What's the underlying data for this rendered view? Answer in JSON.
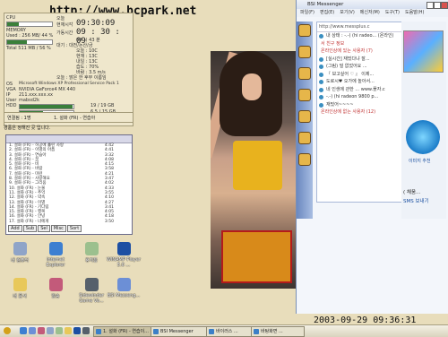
{
  "watermark": "http://www.bcpark.net",
  "sysinfo": {
    "cpu_label": "CPU",
    "cpu_usage": 0.25,
    "memory_label": "MEMORY",
    "memory_text": "Used : 256 MB/ 44 %",
    "memory_usage": 0.44,
    "total_text": "Total 511 MB / 56 %",
    "today_label": "오늘",
    "clock_label": "현재시각",
    "clock": "09:30:09",
    "uptime_label": "가동시간",
    "uptime": "09 : 30 : 09",
    "uptime_sub": "00 시 43 분",
    "weather_label": "대기 : 대전/논산/금",
    "temp": "오늘 : 10C",
    "temp2": "현재 : 13C",
    "temp3": "내일 : 13C",
    "temp4": "습도 : 70%",
    "temp5": "바람 : 3.5 m/s",
    "weather_note": "오늘 : 맑은 한 후부 이름임",
    "os_label": "OS",
    "os": "Microsoft Windows XP Professional Service Pack 1",
    "vga_label": "VGA",
    "vga": "NVIDIA GeForce4 MX 440",
    "ip_label": "IP",
    "ip": "211.xxx.xxx.xx",
    "user_label": "User",
    "user": "mabsd2k",
    "hdd_label": "HDD",
    "hdd_c": "19 / 19 GB",
    "hdd_d": "6.5 / 15 GB",
    "hdd_c_usage": 0.99,
    "hdd_d_usage": 0.43
  },
  "status_strip": {
    "connect": "연결됨 : 1명",
    "track": "1. 설화 (FR) - 연습아"
  },
  "notice": "경품은 정해진 곳 입니다.",
  "media_window": {
    "rows": [
      {
        "title": "1. 설화 (FR) - 허공에 흘린 사랑",
        "dur": "4:42"
      },
      {
        "title": "2. 설화 (FR) - 이별의 아픔",
        "dur": "4:41"
      },
      {
        "title": "3. 설화 (FR) - 연습아",
        "dur": "3:32"
      },
      {
        "title": "4. 설화 (FR) - 꿈",
        "dur": "4:08"
      },
      {
        "title": "5. 설화 (FR) - 비",
        "dur": "4:15"
      },
      {
        "title": "6. 설화 (FR) - 바람",
        "dur": "3:58"
      },
      {
        "title": "7. 설화 (FR) - 미련",
        "dur": "4:21"
      },
      {
        "title": "8. 설화 (FR) - 사랑해요",
        "dur": "3:47"
      },
      {
        "title": "9. 설화 (FR) - 그리움",
        "dur": "4:02"
      },
      {
        "title": "10. 설화 (FR) - 눈물",
        "dur": "4:33"
      },
      {
        "title": "11. 설화 (FR) - 추억",
        "dur": "3:55"
      },
      {
        "title": "12. 설화 (FR) - 약속",
        "dur": "4:10"
      },
      {
        "title": "13. 설화 (FR) - 이별",
        "dur": "4:27"
      },
      {
        "title": "14. 설화 (FR) - 기다림",
        "dur": "3:41"
      },
      {
        "title": "15. 설화 (FR) - 행복",
        "dur": "4:05"
      },
      {
        "title": "16. 설화 (FR) - 안녕",
        "dur": "4:18"
      },
      {
        "title": "17. 설화 (FR) - 너에게",
        "dur": "3:50"
      }
    ],
    "buttons": [
      "Add",
      "Sub",
      "Sel",
      "Misc",
      "Sort"
    ]
  },
  "desktop_icons": [
    {
      "label": "내 컴퓨터",
      "color": "#8fa4c8"
    },
    {
      "label": "Internet Explorer",
      "color": "#3d7fd1"
    },
    {
      "label": "휴지통",
      "color": "#9cc08e"
    },
    {
      "label": "WINAMP Player 5.0 ...",
      "color": "#1d4fa3"
    },
    {
      "label": "내 문서",
      "color": "#e8c85a"
    },
    {
      "label": "알송",
      "color": "#c35a7a"
    },
    {
      "label": "Sidewinder Game Vo...",
      "color": "#56606b"
    },
    {
      "label": "BSI Messeng...",
      "color": "#6c8fd6"
    }
  ],
  "messenger": {
    "title": "BSI Messenger",
    "menu": [
      "파일(F)",
      "편집(E)",
      "보기(V)",
      "메신저(M)",
      "도구(T)",
      "도움말(H)"
    ],
    "url": "http://www.messplus.c",
    "contacts": [
      {
        "text": "내 상태 : -.-) (hi radeo... (온라인)",
        "group": false
      },
      {
        "text": "서 친구 정보",
        "group": true
      },
      {
        "text": "온라인상에 있는 사용자 (7)",
        "group": true
      },
      {
        "text": "[실시간] 재밌다냐 잘...",
        "group": false
      },
      {
        "text": "(그림) 덜 없었어요 ...",
        "group": false
      },
      {
        "text": "『 보고싶어 ♡ 』 이제...",
        "group": false
      },
      {
        "text": "도로시♥ 오가에 놀아서...",
        "group": false
      },
      {
        "text": "네 인생에 관한 ... www.플자.c",
        "group": false
      },
      {
        "text": "-.-) (hi radeon 9800 p...",
        "group": false
      },
      {
        "text": "재밌어~~~~",
        "group": false
      },
      {
        "text": "온라인상에 없는 사용자 (12)",
        "group": true
      }
    ],
    "promo_label": "이미지 추천",
    "right_text": "( 채움...",
    "sms_label": "SMS 보내기"
  },
  "datetime": "2003-09-29 09:36:31",
  "taskbar": {
    "buttons": [
      {
        "label": "1. 설화 (FR) - 연습이...",
        "active": true
      },
      {
        "label": "BSI Messenger",
        "active": false
      },
      {
        "label": "바이러스 ...",
        "active": false
      },
      {
        "label": "바탕화면 ...",
        "active": false
      }
    ]
  }
}
